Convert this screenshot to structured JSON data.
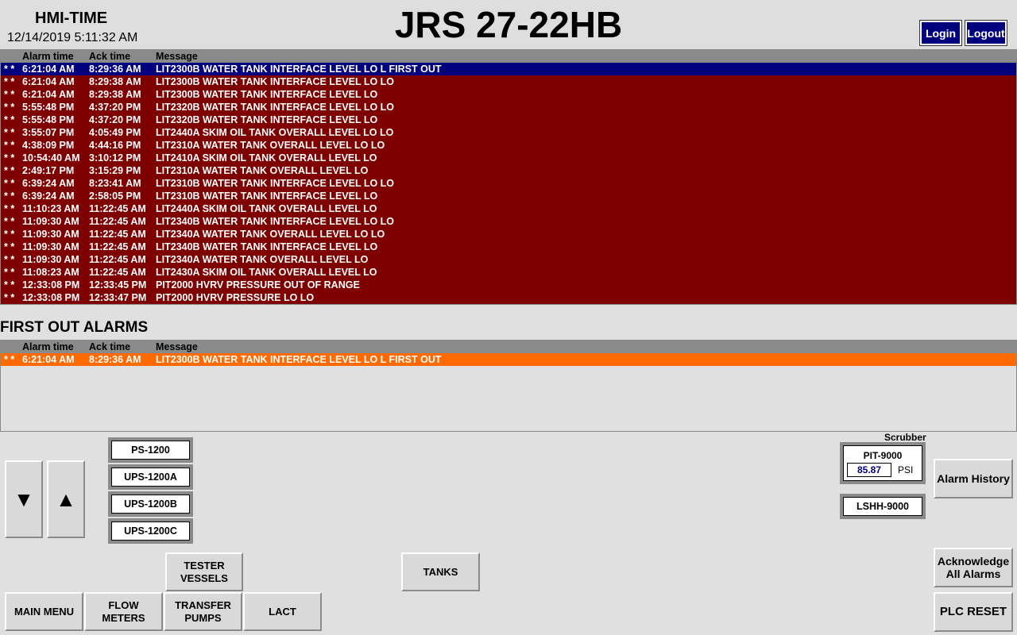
{
  "header": {
    "hmi_label": "HMI-TIME",
    "datetime": "12/14/2019 5:11:32 AM",
    "site_title": "JRS 27-22HB",
    "login_label": "Login",
    "logout_label": "Logout"
  },
  "alarm_table": {
    "columns": [
      "Alarm time",
      "Ack time",
      "Message"
    ],
    "rows": [
      {
        "mark": "*  *",
        "alarm_time": "6:21:04 AM",
        "ack_time": "8:29:36 AM",
        "message": "LIT2300B WATER TANK INTERFACE LEVEL LO L FIRST OUT",
        "selected": true
      },
      {
        "mark": "*  *",
        "alarm_time": "6:21:04 AM",
        "ack_time": "8:29:38 AM",
        "message": "LIT2300B WATER TANK INTERFACE LEVEL LO LO"
      },
      {
        "mark": "*  *",
        "alarm_time": "6:21:04 AM",
        "ack_time": "8:29:38 AM",
        "message": "LIT2300B WATER TANK INTERFACE LEVEL LO"
      },
      {
        "mark": "*  *",
        "alarm_time": "5:55:48 PM",
        "ack_time": "4:37:20 PM",
        "message": "LIT2320B WATER TANK INTERFACE LEVEL LO LO"
      },
      {
        "mark": "*  *",
        "alarm_time": "5:55:48 PM",
        "ack_time": "4:37:20 PM",
        "message": "LIT2320B WATER TANK INTERFACE LEVEL LO"
      },
      {
        "mark": "*  *",
        "alarm_time": "3:55:07 PM",
        "ack_time": "4:05:49 PM",
        "message": "LIT2440A SKIM OIL TANK OVERALL LEVEL LO LO"
      },
      {
        "mark": "*  *",
        "alarm_time": "4:38:09 PM",
        "ack_time": "4:44:16 PM",
        "message": "LIT2310A WATER TANK OVERALL LEVEL LO LO"
      },
      {
        "mark": "*  *",
        "alarm_time": "10:54:40 AM",
        "ack_time": "3:10:12 PM",
        "message": "LIT2410A SKIM OIL TANK OVERALL LEVEL LO"
      },
      {
        "mark": "*  *",
        "alarm_time": "2:49:17 PM",
        "ack_time": "3:15:29 PM",
        "message": "LIT2310A WATER TANK OVERALL LEVEL LO"
      },
      {
        "mark": "*  *",
        "alarm_time": "6:39:24 AM",
        "ack_time": "8:23:41 AM",
        "message": "LIT2310B WATER TANK INTERFACE LEVEL LO LO"
      },
      {
        "mark": "*  *",
        "alarm_time": "6:39:24 AM",
        "ack_time": "2:58:05 PM",
        "message": "LIT2310B WATER TANK INTERFACE LEVEL LO"
      },
      {
        "mark": "*  *",
        "alarm_time": "11:10:23 AM",
        "ack_time": "11:22:45 AM",
        "message": "LIT2440A SKIM OIL TANK OVERALL LEVEL LO"
      },
      {
        "mark": "*  *",
        "alarm_time": "11:09:30 AM",
        "ack_time": "11:22:45 AM",
        "message": "LIT2340B WATER TANK INTERFACE LEVEL LO LO"
      },
      {
        "mark": "*  *",
        "alarm_time": "11:09:30 AM",
        "ack_time": "11:22:45 AM",
        "message": "LIT2340A WATER TANK OVERALL LEVEL LO LO"
      },
      {
        "mark": "*  *",
        "alarm_time": "11:09:30 AM",
        "ack_time": "11:22:45 AM",
        "message": "LIT2340B WATER TANK INTERFACE LEVEL LO"
      },
      {
        "mark": "*  *",
        "alarm_time": "11:09:30 AM",
        "ack_time": "11:22:45 AM",
        "message": "LIT2340A WATER TANK OVERALL LEVEL LO"
      },
      {
        "mark": "*  *",
        "alarm_time": "11:08:23 AM",
        "ack_time": "11:22:45 AM",
        "message": "LIT2430A SKIM OIL TANK OVERALL LEVEL LO"
      },
      {
        "mark": "*  *",
        "alarm_time": "12:33:08 PM",
        "ack_time": "12:33:45 PM",
        "message": "PIT2000 HVRV PRESSURE OUT OF RANGE"
      },
      {
        "mark": "*  *",
        "alarm_time": "12:33:08 PM",
        "ack_time": "12:33:47 PM",
        "message": "PIT2000 HVRV PRESSURE LO LO"
      }
    ]
  },
  "first_out": {
    "title": "FIRST OUT ALARMS",
    "columns": [
      "Alarm time",
      "Ack time",
      "Message"
    ],
    "rows": [
      {
        "mark": "*  *",
        "alarm_time": "6:21:04 AM",
        "ack_time": "8:29:36 AM",
        "message": "LIT2300B WATER TANK INTERFACE LEVEL LO L FIRST OUT"
      }
    ]
  },
  "scroll": {
    "down_icon": "arrow-down-icon",
    "up_icon": "arrow-up-icon",
    "down_glyph": "▼",
    "up_glyph": "▲"
  },
  "ps_buttons": [
    "PS-1200",
    "UPS-1200A",
    "UPS-1200B",
    "UPS-1200C"
  ],
  "scrubber": {
    "title": "Scrubber",
    "pit_label": "PIT-9000",
    "pit_value": "85.87",
    "pit_unit": "PSI",
    "lshh_label": "LSHH-9000"
  },
  "nav": {
    "alarm_history": "Alarm History",
    "tester_vessels": "TESTER VESSELS",
    "tanks": "TANKS",
    "main_menu": "MAIN MENU",
    "flow_meters": "FLOW METERS",
    "transfer_pumps": "TRANSFER PUMPS",
    "lact": "LACT",
    "acknowledge_all": "Acknowledge All Alarms",
    "plc_reset": "PLC RESET"
  },
  "colors": {
    "alarm_row_bg": "#7f0000",
    "selected_row_bg": "#00007f",
    "first_out_row_bg": "#ff6a00",
    "header_row_bg": "#8a8a8a",
    "pit_value_color": "#00007f"
  }
}
